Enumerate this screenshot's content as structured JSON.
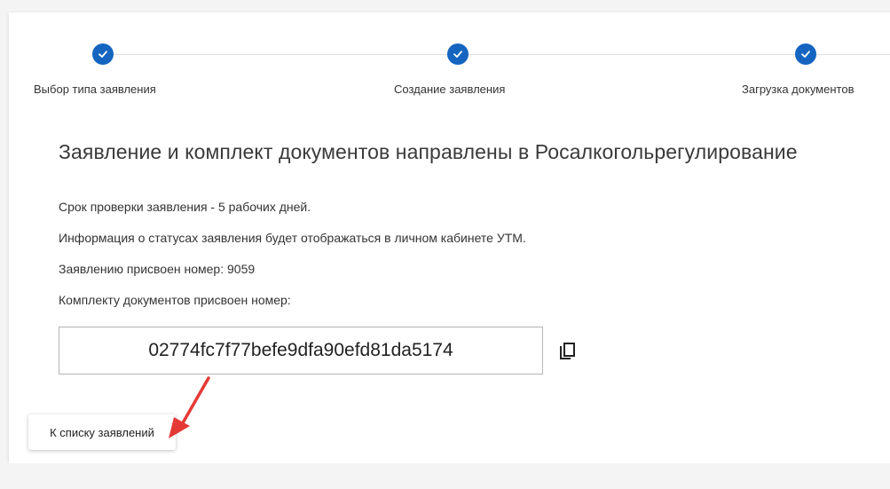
{
  "stepper": {
    "steps": [
      {
        "label": "Выбор типа заявления",
        "status": "completed",
        "icon": "check-icon"
      },
      {
        "label": "Создание заявления",
        "status": "completed",
        "icon": "check-icon"
      },
      {
        "label": "Загрузка документов",
        "status": "completed",
        "icon": "check-icon"
      }
    ]
  },
  "main": {
    "title": "Заявление и комплект документов направлены в Росалкогольрегулирование",
    "lines": [
      "Срок проверки заявления - 5 рабочих дней.",
      "Информация о статусах заявления будет отображаться в личном кабинете УТМ.",
      "Заявлению присвоен номер: 9059",
      "Комплекту документов присвоен номер:"
    ],
    "package_number": "02774fc7f77befe9dfa90efd81da5174",
    "copy_icon": "copy-icon"
  },
  "actions": {
    "back_label": "К списку заявлений"
  },
  "colors": {
    "accent": "#1565c0",
    "annotation_arrow": "#e53935"
  }
}
